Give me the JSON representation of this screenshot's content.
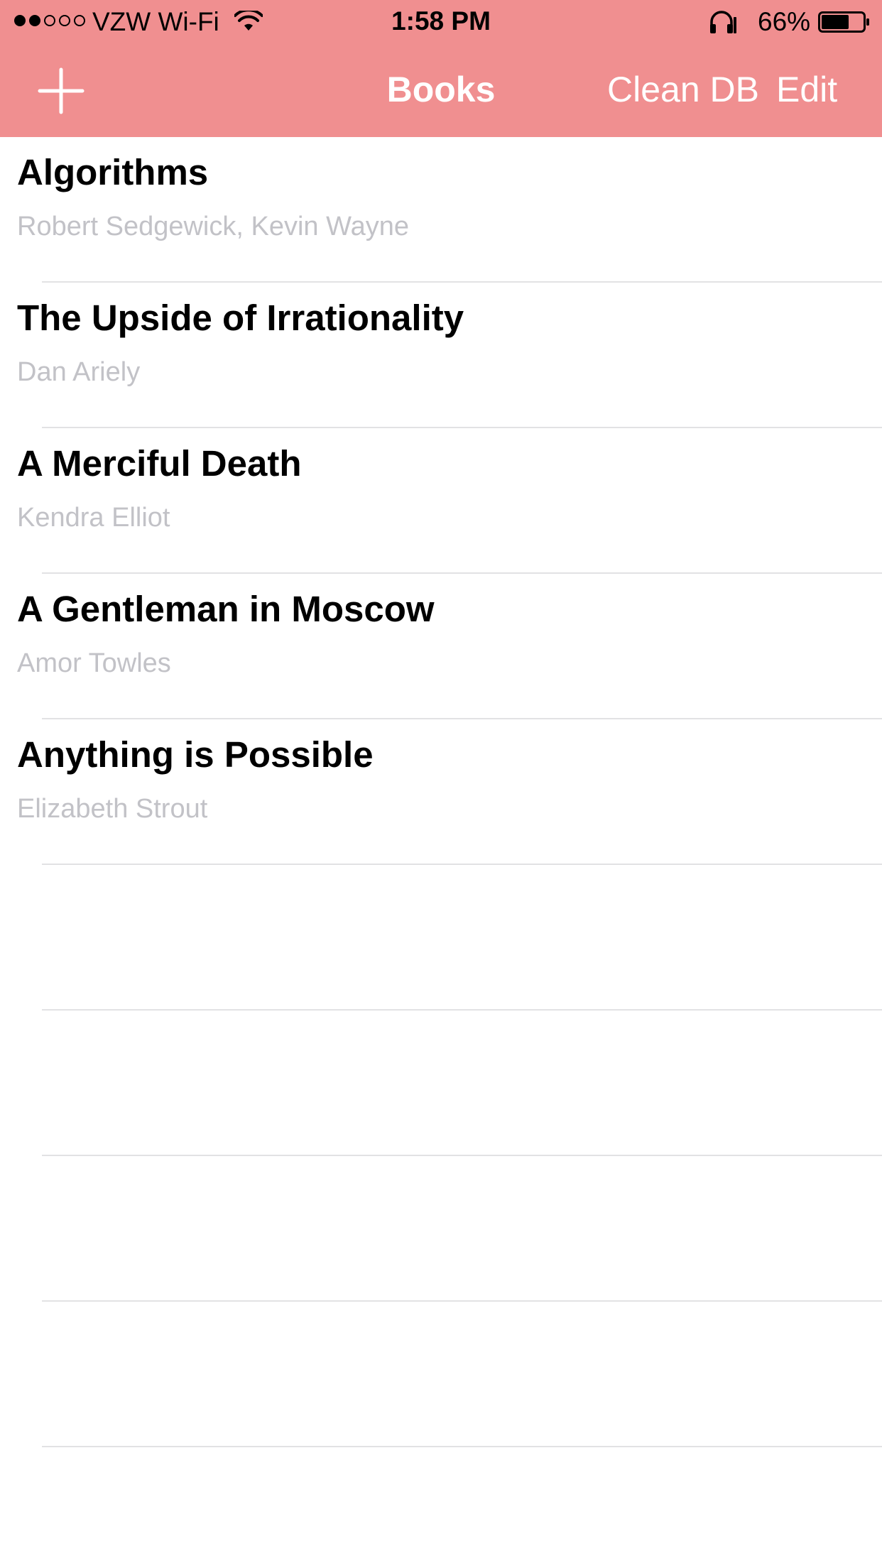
{
  "status_bar": {
    "signal_dots": [
      "full",
      "full",
      "empty",
      "empty",
      "empty"
    ],
    "carrier": "VZW Wi-Fi",
    "time": "1:58 PM",
    "battery_percent": "66%",
    "battery_level": 0.66
  },
  "nav": {
    "add_icon": "plus-icon",
    "title": "Books",
    "clean_label": "Clean DB",
    "edit_label": "Edit"
  },
  "colors": {
    "header_bg": "#f08f90",
    "subtitle_gray": "#c2c2c7",
    "separator": "#e2e2e4"
  },
  "books": [
    {
      "title": "Algorithms",
      "authors": "Robert Sedgewick, Kevin Wayne"
    },
    {
      "title": "The Upside of Irrationality",
      "authors": "Dan Ariely"
    },
    {
      "title": "A Merciful Death",
      "authors": "Kendra Elliot"
    },
    {
      "title": "A Gentleman in Moscow",
      "authors": "Amor Towles"
    },
    {
      "title": "Anything is Possible",
      "authors": "Elizabeth Strout"
    }
  ]
}
